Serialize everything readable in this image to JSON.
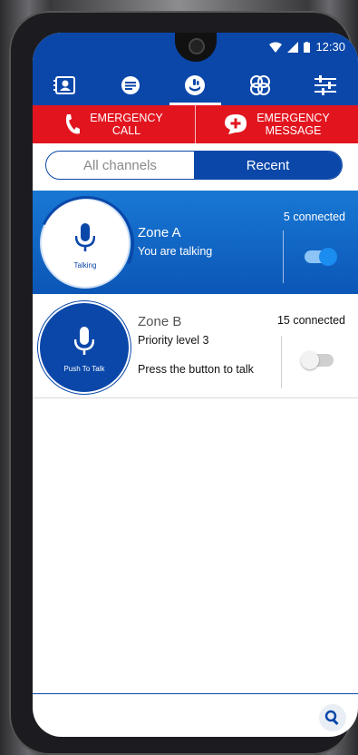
{
  "status": {
    "time": "12:30"
  },
  "nav": {
    "items": [
      {
        "icon": "contacts-icon"
      },
      {
        "icon": "messages-icon"
      },
      {
        "icon": "talk-channels-icon",
        "active": true
      },
      {
        "icon": "group-icon"
      },
      {
        "icon": "settings-sliders-icon"
      }
    ]
  },
  "emergency": {
    "call_line1": "EMERGENCY",
    "call_line2": "CALL",
    "message_line1": "EMERGENCY",
    "message_line2": "MESSAGE"
  },
  "tabs": {
    "all_channels": "All channels",
    "recent": "Recent",
    "selected": "Recent"
  },
  "zones": [
    {
      "name": "Zone A",
      "subtitle": "You are talking",
      "circle_caption": "Talking",
      "connected": "5 connected",
      "enabled": true
    },
    {
      "name": "Zone B",
      "priority": "Priority level 3",
      "hint": "Press the button to talk",
      "circle_caption": "Push To Talk",
      "connected": "15 connected",
      "enabled": false
    }
  ],
  "colors": {
    "brand_blue": "#0a47a9",
    "emergency_red": "#e2151f",
    "active_blue": "#1978d4"
  }
}
